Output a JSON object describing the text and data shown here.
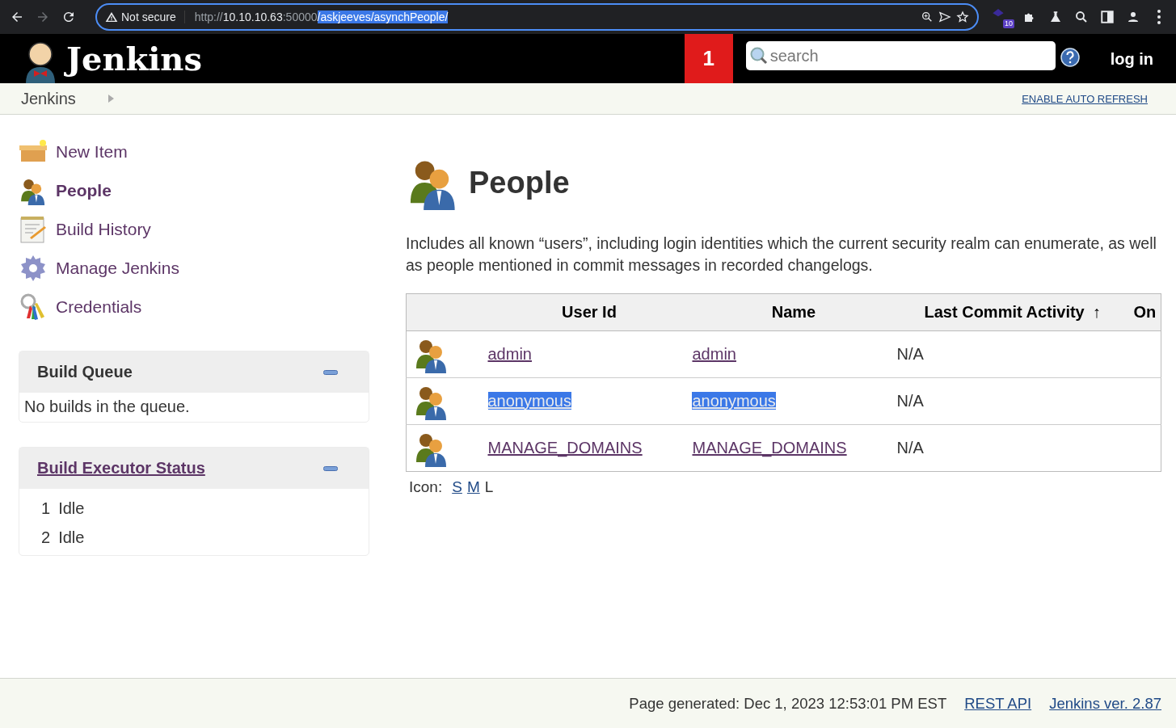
{
  "browser": {
    "back_enabled": true,
    "forward_enabled": false,
    "security": "Not secure",
    "url": [
      {
        "text": "http://",
        "kind": "dim",
        "selected": false
      },
      {
        "text": "10.10.10.63",
        "kind": "host",
        "selected": false
      },
      {
        "text": ":50000",
        "kind": "dim",
        "selected": false
      },
      {
        "text": "/askjeeves/asynchPeople/",
        "kind": "path",
        "selected": true
      }
    ],
    "extension_badge": "10"
  },
  "header": {
    "logo": "Jenkins",
    "notification_count": "1",
    "search": {
      "placeholder": "search"
    },
    "login": "log in"
  },
  "breadcrumb": {
    "items": [
      "Jenkins"
    ],
    "auto_refresh": "ENABLE AUTO REFRESH"
  },
  "sidebar": {
    "tasks": [
      {
        "label": "New Item",
        "kind": "box",
        "selected": false
      },
      {
        "label": "People",
        "kind": "people",
        "selected": true
      },
      {
        "label": "Build History",
        "kind": "notepad",
        "selected": false
      },
      {
        "label": "Manage Jenkins",
        "kind": "gear",
        "selected": false
      },
      {
        "label": "Credentials",
        "kind": "keys",
        "selected": false
      }
    ]
  },
  "build_queue": {
    "title": "Build Queue",
    "message": "No builds in the queue."
  },
  "executors": {
    "title": "Build Executor Status",
    "items": [
      {
        "number": "1",
        "status": "Idle"
      },
      {
        "number": "2",
        "status": "Idle"
      }
    ]
  },
  "page": {
    "title": "People",
    "description": "Includes all known “users”, including login identities which the current security realm can enumerate, as well as people mentioned in commit messages in recorded changelogs."
  },
  "table": {
    "columns": [
      {
        "label": "User Id"
      },
      {
        "label": "Name"
      },
      {
        "label": "Last Commit Activity",
        "sort": "↑"
      },
      {
        "label": "On"
      }
    ],
    "rows": [
      {
        "user_id": {
          "text": "admin",
          "highlighted": false
        },
        "name": {
          "text": "admin",
          "highlighted": false
        },
        "last_commit": "N/A"
      },
      {
        "user_id": {
          "text": "anonymous ",
          "highlighted": true
        },
        "name": {
          "text": "anonymous",
          "highlighted": true
        },
        "last_commit": "N/A"
      },
      {
        "user_id": {
          "text": "MANAGE_DOMAINS",
          "highlighted": false
        },
        "name": {
          "text": "MANAGE_DOMAINS",
          "highlighted": false
        },
        "last_commit": "N/A"
      }
    ]
  },
  "icon_size": {
    "label": "Icon:",
    "sizes": [
      {
        "label": "S",
        "selected": false
      },
      {
        "label": "M",
        "selected": false
      },
      {
        "label": "L",
        "selected": true
      }
    ]
  },
  "footer": {
    "generated": "Page generated: Dec 1, 2023 12:53:01 PM EST",
    "links": [
      "REST API",
      "Jenkins ver. 2.87"
    ]
  }
}
